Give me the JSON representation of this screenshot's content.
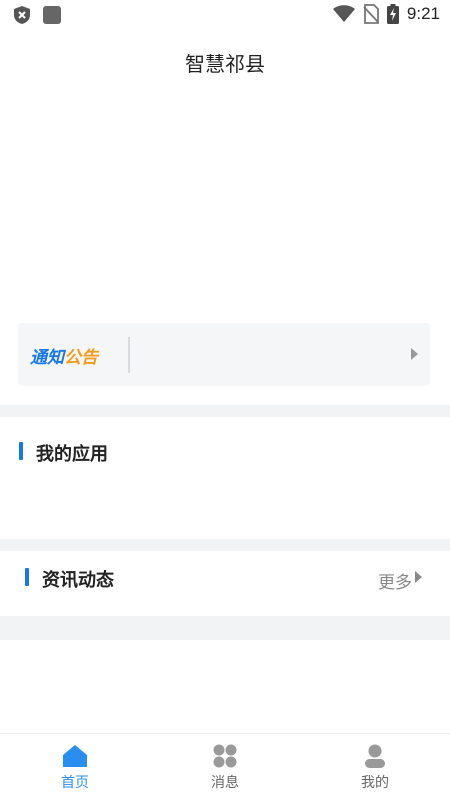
{
  "status_bar": {
    "time": "9:21"
  },
  "app": {
    "title": "智慧祁县"
  },
  "notice": {
    "logo_part1": "通知",
    "logo_part2": "公告"
  },
  "sections": {
    "my_apps": {
      "title": "我的应用"
    },
    "news": {
      "title": "资讯动态",
      "more_label": "更多"
    }
  },
  "tab_bar": {
    "tabs": [
      {
        "label": "首页",
        "icon": "home-icon",
        "active": true
      },
      {
        "label": "消息",
        "icon": "grid-icon",
        "active": false
      },
      {
        "label": "我的",
        "icon": "user-icon",
        "active": false
      }
    ]
  },
  "colors": {
    "accent": "#1677e8",
    "tab_active": "#2a8ef0",
    "notice_orange": "#f39c1a",
    "gap_bg": "#f2f3f5"
  }
}
